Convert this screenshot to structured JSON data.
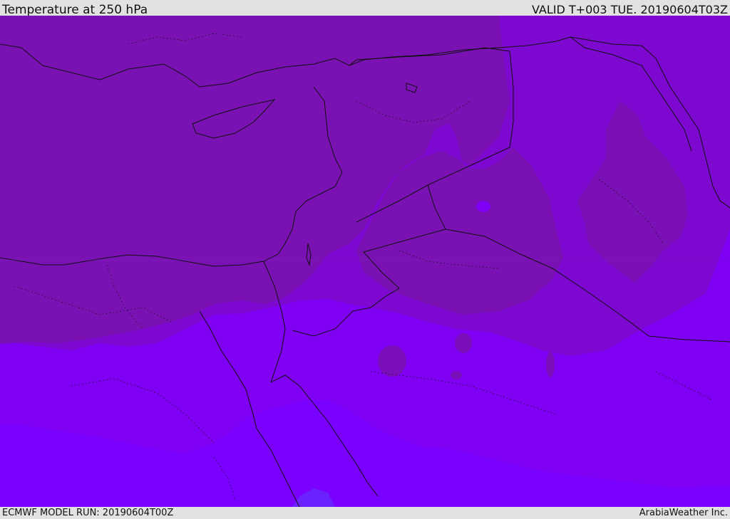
{
  "header": {
    "title": "Temperature at 250 hPa",
    "valid": "VALID T+003 TUE. 20190604T03Z"
  },
  "footer": {
    "model_run": "ECMWF MODEL RUN: 20190604T00Z",
    "brand": "ArabiaWeather Inc."
  },
  "map": {
    "field": "temperature",
    "level": "250 hPa",
    "palette": {
      "band_warmest": "#7a12b3",
      "band_warm": "#7d08cf",
      "band_mid": "#7e00df",
      "band_cool": "#7f00f2",
      "band_cold": "#7a00ff",
      "band_coldest": "#6a22ff",
      "coastline": "#101010",
      "border": "#101010"
    }
  }
}
